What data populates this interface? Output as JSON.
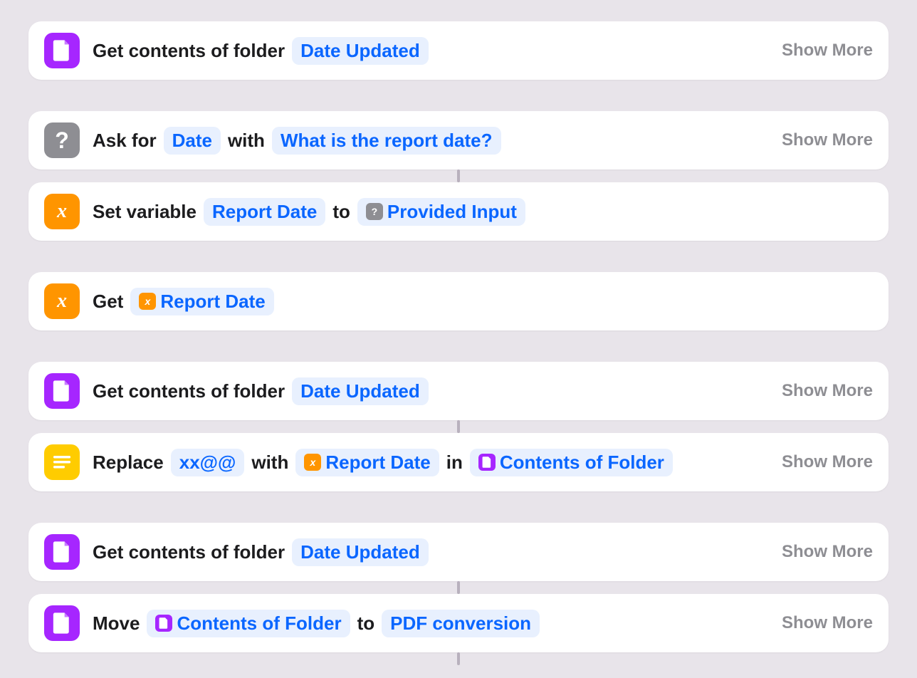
{
  "common": {
    "show_more": "Show More"
  },
  "actions": [
    {
      "title": "Get contents of folder",
      "param1": "Date Updated"
    },
    {
      "title": "Ask for",
      "param1": "Date",
      "joiner1": "with",
      "param2": "What is the report date?"
    },
    {
      "title": "Set variable",
      "param1": "Report Date",
      "joiner1": "to",
      "param2": "Provided Input"
    },
    {
      "title": "Get",
      "param1": "Report Date"
    },
    {
      "title": "Get contents of folder",
      "param1": "Date Updated"
    },
    {
      "title": "Replace",
      "param1": "xx@@",
      "joiner1": "with",
      "param2": "Report Date",
      "joiner2": "in",
      "param3": "Contents of Folder"
    },
    {
      "title": "Get contents of folder",
      "param1": "Date Updated"
    },
    {
      "title": "Move",
      "param1": "Contents of Folder",
      "joiner1": "to",
      "param2": "PDF conversion"
    }
  ]
}
